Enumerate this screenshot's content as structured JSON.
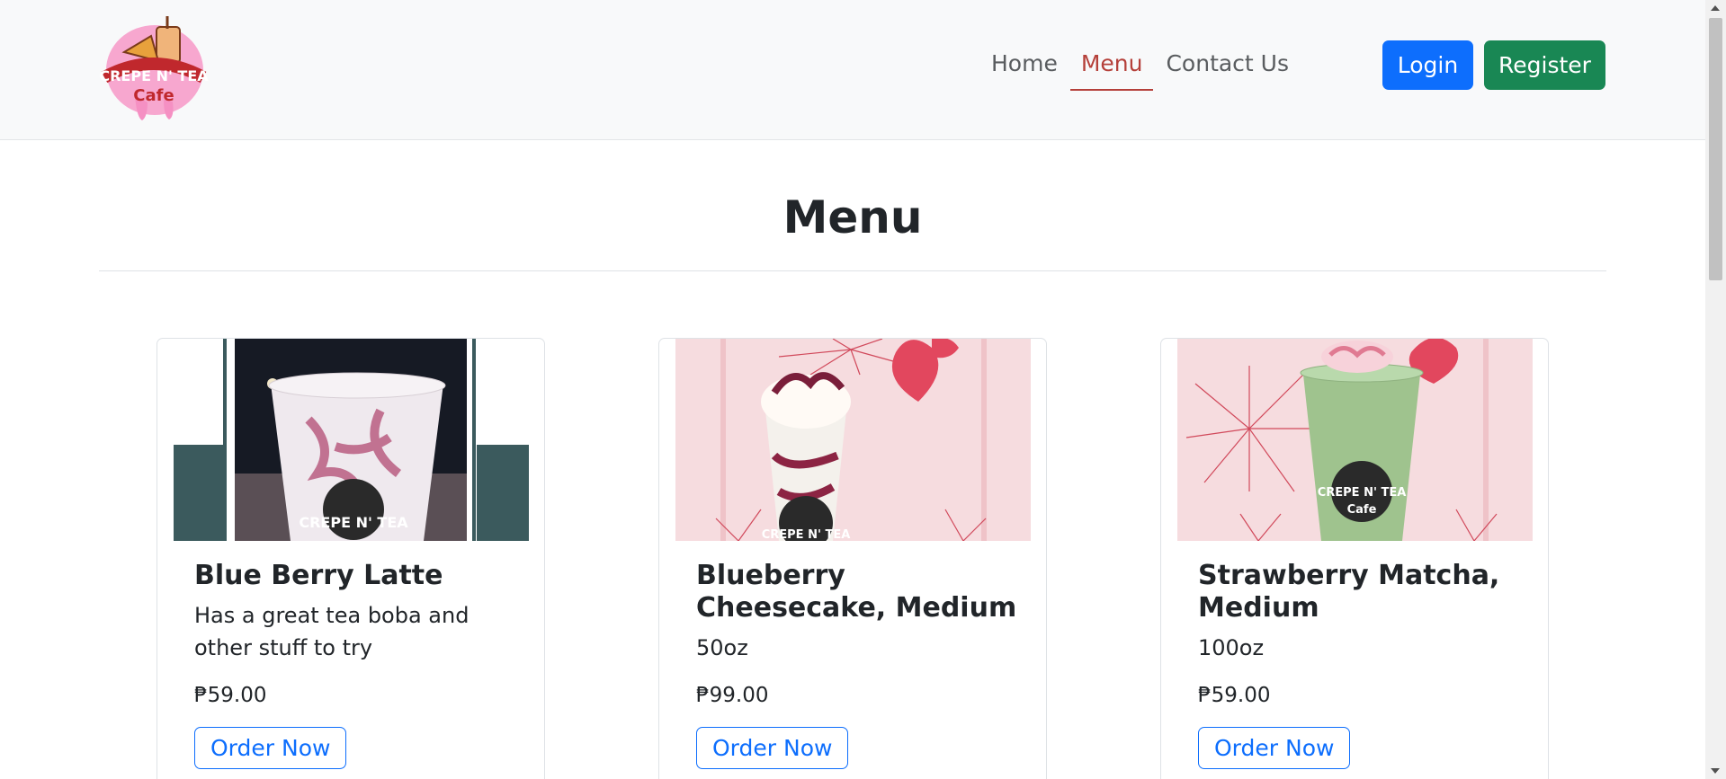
{
  "brand": {
    "logo_text_line1": "CREPE N' TEA",
    "logo_text_line2": "Cafe"
  },
  "nav": {
    "items": [
      {
        "label": "Home",
        "active": false
      },
      {
        "label": "Menu",
        "active": true
      },
      {
        "label": "Contact Us",
        "active": false
      }
    ],
    "login_label": "Login",
    "register_label": "Register"
  },
  "main": {
    "title": "Menu",
    "products": [
      {
        "name": "Blue Berry Latte",
        "description": "Has a great tea boba and other stuff to try",
        "price": "₱59.00",
        "order_label": "Order Now"
      },
      {
        "name": "Blueberry Cheesecake, Medium",
        "description": "50oz",
        "price": "₱99.00",
        "order_label": "Order Now"
      },
      {
        "name": "Strawberry Matcha, Medium",
        "description": "100oz",
        "price": "₱59.00",
        "order_label": "Order Now"
      }
    ]
  },
  "colors": {
    "primary": "#0d6efd",
    "success": "#198754",
    "active_link": "#b5403a",
    "card_bg_pink": "#f6dcdf",
    "teal": "#3b5a5d"
  }
}
